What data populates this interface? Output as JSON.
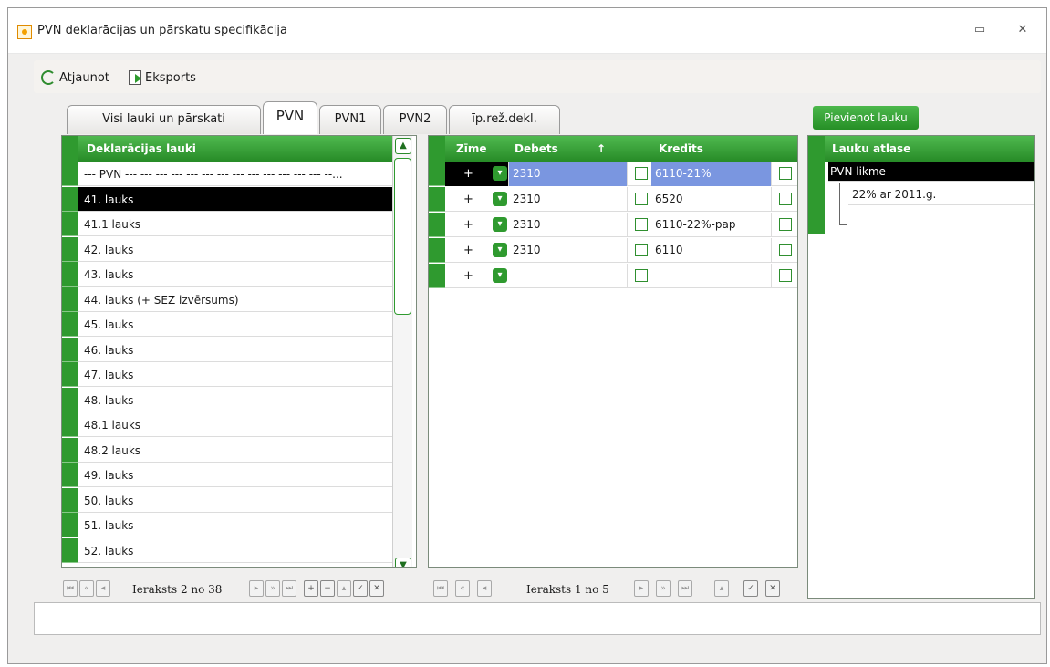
{
  "window": {
    "title": "PVN deklarācijas un pārskatu specifikācija"
  },
  "toolbar": {
    "refresh_label": "Atjaunot",
    "export_label": "Eksports"
  },
  "tabs": [
    {
      "label": "Visi lauki un pārskati"
    },
    {
      "label": "PVN"
    },
    {
      "label": "PVN1"
    },
    {
      "label": "PVN2"
    },
    {
      "label": "īp.rež.dekl."
    }
  ],
  "add_field_label": "Pievienot lauku",
  "left_grid": {
    "header": "Deklarācijas lauki",
    "rows": [
      "--- PVN --- --- --- --- --- --- --- --- --- --- --- --- --- --...",
      "41. lauks",
      "41.1 lauks",
      "42. lauks",
      "43. lauks",
      "44. lauks (+ SEZ izvērsums)",
      "45. lauks",
      "46. lauks",
      "47. lauks",
      "48. lauks",
      "48.1 lauks",
      "48.2 lauks",
      "49. lauks",
      "50. lauks",
      "51. lauks",
      "52. lauks"
    ],
    "nav_text": "Ieraksts 2 no 38"
  },
  "mid_grid": {
    "headers": {
      "zime": "Zīme",
      "debets": "Debets",
      "kredits": "Kredīts"
    },
    "rows": [
      {
        "sign": "+",
        "debets": "2310",
        "kredits": "6110-21%"
      },
      {
        "sign": "+",
        "debets": "2310",
        "kredits": "6520"
      },
      {
        "sign": "+",
        "debets": "2310",
        "kredits": "6110-22%-pap"
      },
      {
        "sign": "+",
        "debets": "2310",
        "kredits": "6110"
      },
      {
        "sign": "+",
        "debets": "",
        "kredits": ""
      }
    ],
    "nav_text": "Ieraksts 1 no 5"
  },
  "right_grid": {
    "header": "Lauku atlase",
    "root": "PVN likme",
    "child": "22% ar 2011.g."
  },
  "colors": {
    "accent": "#2f9a2f",
    "selection": "#7a96e0"
  }
}
